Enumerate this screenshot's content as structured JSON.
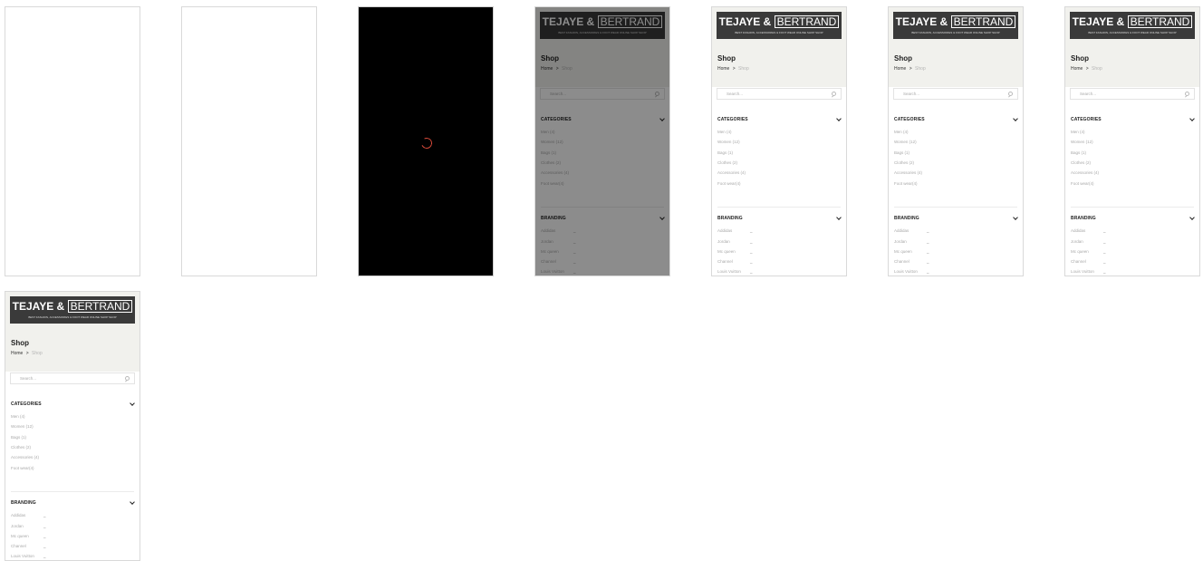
{
  "logo": {
    "name_left": "TEJAYE &",
    "name_right": "BERTRAND",
    "tagline": "BEST FASHION, ACCESSORIES & FOOT WEAR ONLINE SHOP SHOP"
  },
  "page": {
    "title": "Shop",
    "breadcrumb_home": "Home",
    "breadcrumb_sep": ">",
    "breadcrumb_current": "Shop"
  },
  "search": {
    "placeholder": "Search..."
  },
  "categories": {
    "heading": "CATEGORIES",
    "items": [
      "Men (4)",
      "Women (12)",
      "Bags (1)",
      "Clothes (2)",
      "Accessories (4)",
      "Foot wear(4)"
    ]
  },
  "branding": {
    "heading": "BRANDING",
    "items": [
      "Addidas",
      "Jordan",
      "Mc queen",
      "Channel",
      "Louis Vuitton"
    ],
    "dash": "_"
  },
  "colors": {
    "header_band": "#f1f1ed",
    "logo_bg": "#3a3a3a",
    "spinner": "#d94a3a",
    "loading_bg": "#000000"
  },
  "frames": [
    {
      "state": "blank"
    },
    {
      "state": "blank"
    },
    {
      "state": "loading"
    },
    {
      "state": "dimmed"
    },
    {
      "state": "loaded"
    },
    {
      "state": "loaded"
    },
    {
      "state": "loaded"
    },
    {
      "state": "loaded"
    }
  ]
}
